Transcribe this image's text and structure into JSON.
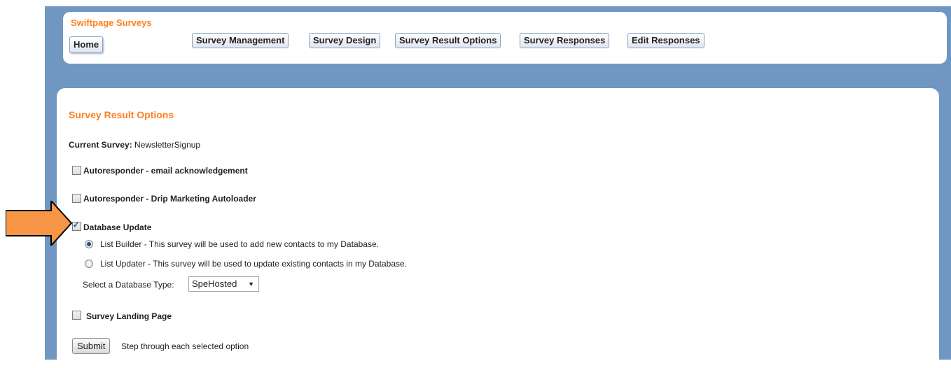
{
  "header": {
    "brand": "Swiftpage Surveys",
    "home_label": "Home",
    "nav": [
      {
        "label": "Survey Management"
      },
      {
        "label": "Survey Design"
      },
      {
        "label": "Survey Result Options"
      },
      {
        "label": "Survey Responses"
      },
      {
        "label": "Edit Responses"
      }
    ]
  },
  "content": {
    "title": "Survey Result Options",
    "current_survey_label": "Current Survey:",
    "current_survey_value": "NewsletterSignup",
    "options": {
      "autoresponder_email": {
        "label": "Autoresponder - email acknowledgement",
        "checked": false
      },
      "autoresponder_drip": {
        "label": "Autoresponder - Drip Marketing Autoloader",
        "checked": false
      },
      "database_update": {
        "label": "Database Update",
        "checked": true
      },
      "survey_landing": {
        "label": "Survey Landing Page",
        "checked": false
      }
    },
    "radios": {
      "list_builder": {
        "label": "List Builder - This survey will be used to add new contacts to my Database.",
        "selected": true
      },
      "list_updater": {
        "label": "List Updater - This survey will be used to update existing contacts in my Database.",
        "selected": false
      }
    },
    "db_type_label": "Select a Database Type:",
    "db_type_value": "SpeHosted",
    "submit_label": "Submit",
    "submit_hint": "Step through each selected option"
  },
  "annotation": {
    "arrow_color": "#f79646",
    "arrow_icon": "right-arrow-icon"
  }
}
